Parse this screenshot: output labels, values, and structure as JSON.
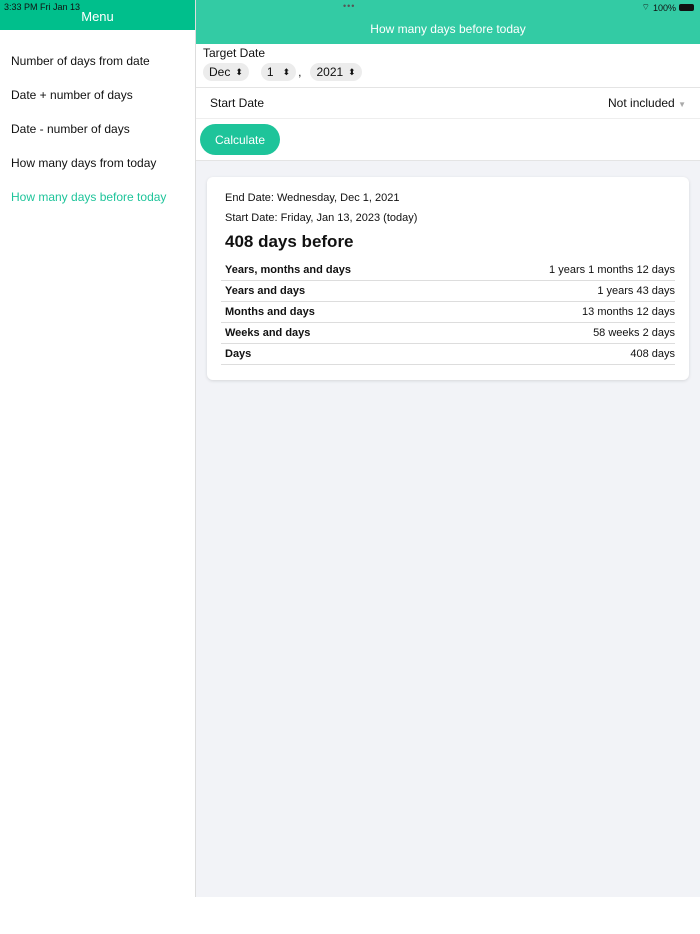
{
  "status": {
    "time": "3:33 PM  Fri Jan 13",
    "battery": "100%"
  },
  "sidebar": {
    "title": "Menu",
    "items": [
      {
        "label": "Number of days from date"
      },
      {
        "label": "Date + number of days"
      },
      {
        "label": "Date - number of days"
      },
      {
        "label": "How many days from today"
      },
      {
        "label": "How many days before today"
      }
    ]
  },
  "header": {
    "title": "How many days before today"
  },
  "form": {
    "target_label": "Target Date",
    "month": "Dec",
    "day": "1",
    "comma": ",",
    "year": "2021",
    "start_label": "Start Date",
    "start_value": "Not included",
    "calculate": "Calculate"
  },
  "result": {
    "end": "End Date: Wednesday, Dec 1, 2021",
    "start": "Start Date: Friday, Jan 13, 2023 (today)",
    "headline": "408 days before",
    "rows": [
      {
        "k": "Years, months and days",
        "v": "1 years 1 months 12 days"
      },
      {
        "k": "Years and days",
        "v": "1 years 43 days"
      },
      {
        "k": "Months and days",
        "v": "13 months 12 days"
      },
      {
        "k": "Weeks and days",
        "v": "58 weeks 2 days"
      },
      {
        "k": "Days",
        "v": "408 days"
      }
    ]
  }
}
